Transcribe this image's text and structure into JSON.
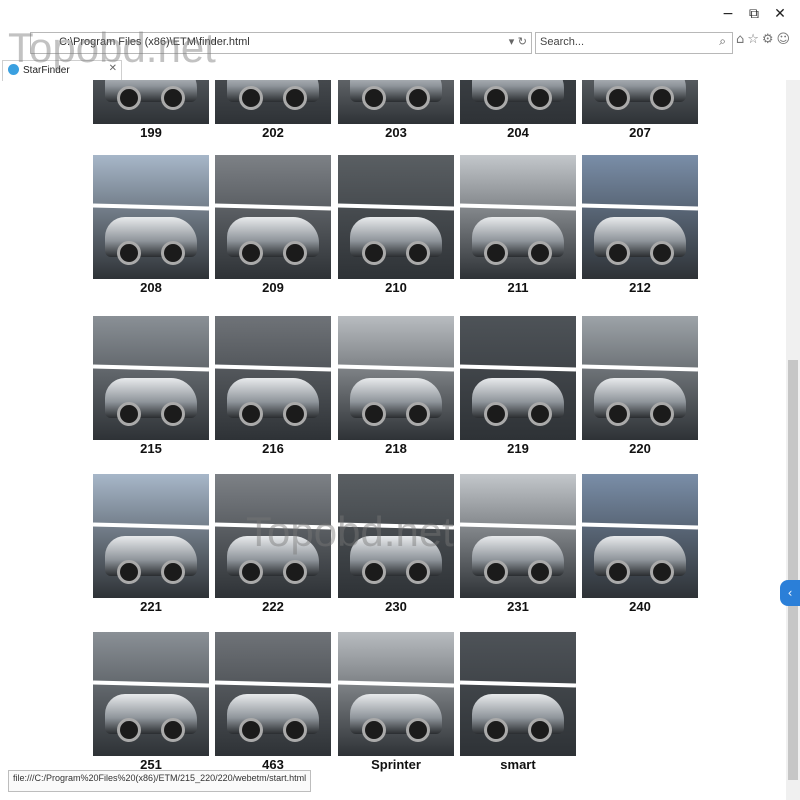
{
  "window": {
    "minimize_glyph": "−",
    "restore_glyph": "⧉",
    "close_glyph": "✕"
  },
  "address_bar": {
    "url": "C:\\Program Files (x86)\\ETM\\finder.html",
    "refresh_glyph": "↻",
    "dropdown_glyph": "▾"
  },
  "search": {
    "placeholder": "Search...",
    "icon_glyph": "⌕"
  },
  "toolbar": {
    "icons": [
      "home-icon",
      "favorites-icon",
      "settings-icon",
      "smiley-icon"
    ],
    "glyphs": "⌂☆⚙☺"
  },
  "tab": {
    "label": "StarFinder",
    "close_glyph": "✕"
  },
  "watermark": "Topobd.net",
  "models": [
    {
      "label": "199"
    },
    {
      "label": "202"
    },
    {
      "label": "203"
    },
    {
      "label": "204"
    },
    {
      "label": "207"
    },
    {
      "label": "208"
    },
    {
      "label": "209"
    },
    {
      "label": "210"
    },
    {
      "label": "211"
    },
    {
      "label": "212"
    },
    {
      "label": "215"
    },
    {
      "label": "216"
    },
    {
      "label": "218"
    },
    {
      "label": "219"
    },
    {
      "label": "220"
    },
    {
      "label": "221"
    },
    {
      "label": "222"
    },
    {
      "label": "230"
    },
    {
      "label": "231"
    },
    {
      "label": "240"
    },
    {
      "label": "251"
    },
    {
      "label": "463"
    },
    {
      "label": "Sprinter"
    },
    {
      "label": "smart"
    }
  ],
  "status_bar": {
    "text": "file:///C:/Program%20Files%20(x86)/ETM/215_220/220/webetm/start.html"
  },
  "side_tab": {
    "glyph": "‹"
  }
}
